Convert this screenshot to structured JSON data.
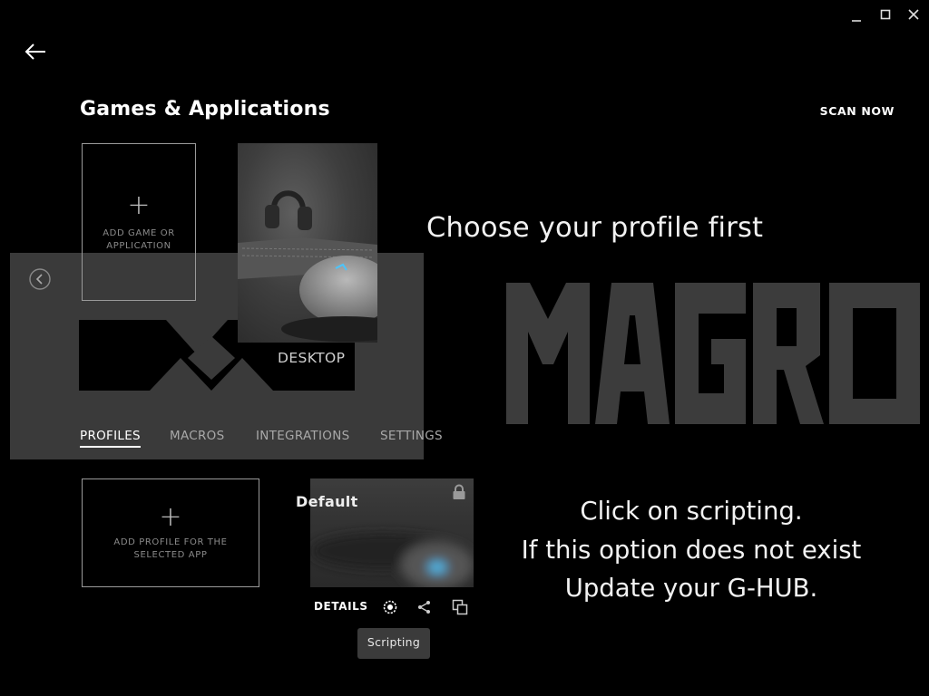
{
  "window": {
    "controls": [
      "minimize-icon",
      "maximize-icon",
      "close-icon"
    ]
  },
  "header": {
    "title": "Games & Applications",
    "scan_label": "SCAN NOW"
  },
  "games": {
    "add_label": "ADD GAME OR APPLICATION",
    "tiles": [
      {
        "label": "DESKTOP",
        "selected": true
      }
    ]
  },
  "annotations": {
    "choose_profile": "Choose your profile first",
    "scripting_hint": [
      "Click on scripting.",
      "If this option does not exist",
      "Update your G-HUB."
    ]
  },
  "tabs": [
    {
      "label": "PROFILES",
      "active": true
    },
    {
      "label": "MACROS",
      "active": false
    },
    {
      "label": "INTEGRATIONS",
      "active": false
    },
    {
      "label": "SETTINGS",
      "active": false
    }
  ],
  "profiles": {
    "add_label": "ADD PROFILE FOR THE SELECTED APP",
    "items": [
      {
        "name": "Default",
        "locked": true
      }
    ],
    "actions": {
      "details_label": "DETAILS",
      "icons": [
        "scripting-icon",
        "share-icon",
        "duplicate-icon"
      ]
    },
    "tooltip": "Scripting"
  },
  "colors": {
    "background": "#000000",
    "watermark": "#3c3c3c",
    "tooltip_bg": "#3b3b3b",
    "accent_led": "#4fc3f7"
  }
}
